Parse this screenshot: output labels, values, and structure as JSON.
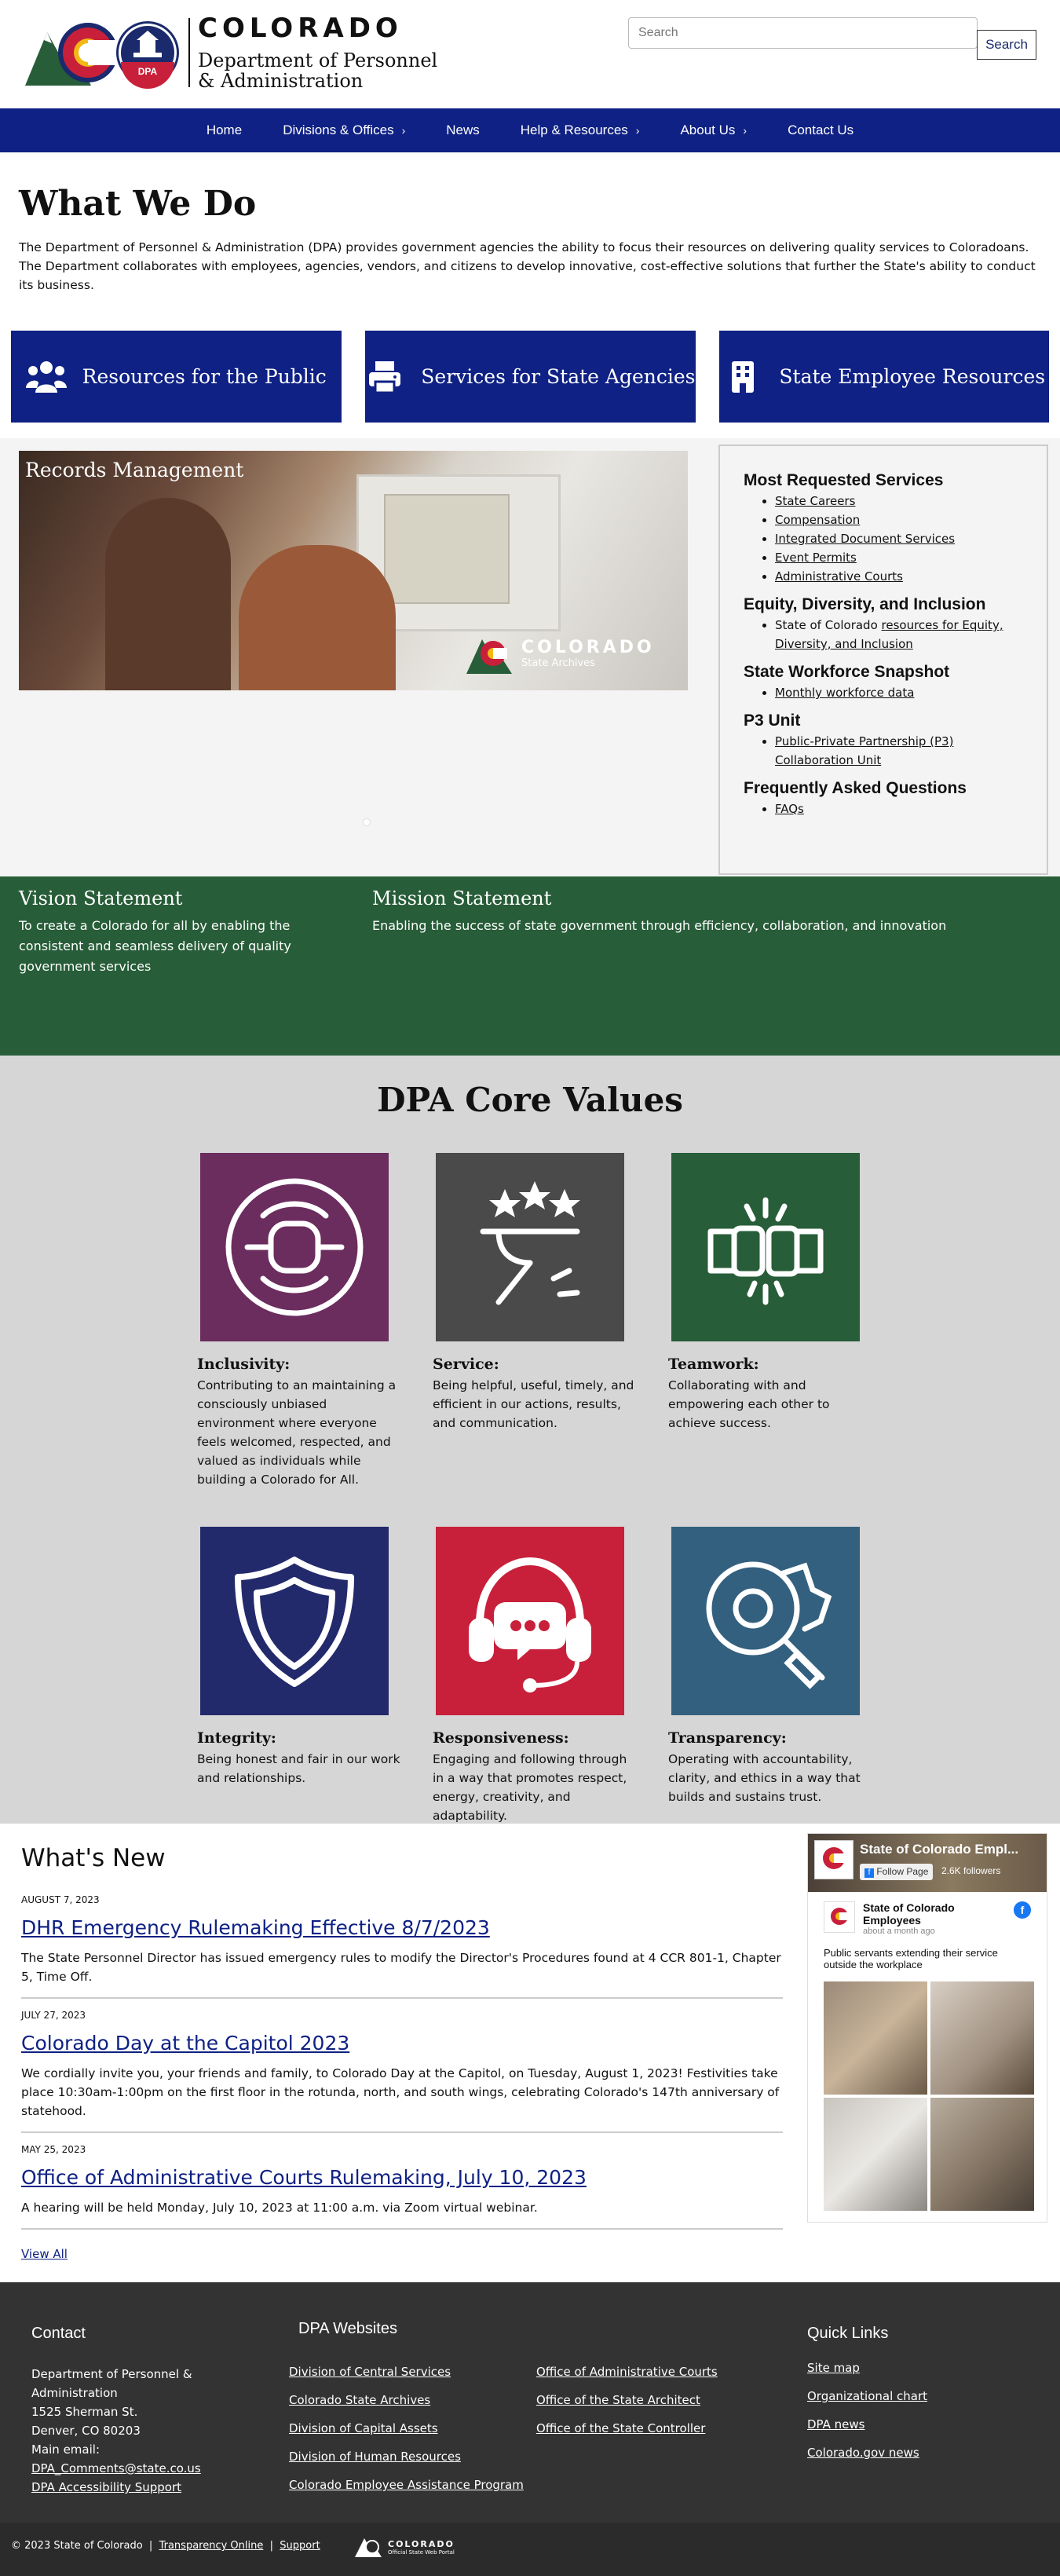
{
  "header": {
    "colorado": "COLORADO",
    "dept_line1": "Department of Personnel",
    "dept_line2": "& Administration",
    "dpa_badge": "DPA",
    "search_placeholder": "Search",
    "search_button": "Search"
  },
  "nav": [
    {
      "label": "Home",
      "chevron": false
    },
    {
      "label": "Divisions & Offices",
      "chevron": true
    },
    {
      "label": "News",
      "chevron": false
    },
    {
      "label": "Help & Resources",
      "chevron": true
    },
    {
      "label": "About Us",
      "chevron": true
    },
    {
      "label": "Contact Us",
      "chevron": false
    }
  ],
  "what_we_do": {
    "title": "What We Do",
    "text": "The Department of Personnel & Administration (DPA) provides government agencies the ability to focus their resources on delivering quality services to Coloradoans. The Department collaborates with employees, agencies, vendors, and citizens to develop innovative, cost-effective solutions that further the State's ability to conduct its business."
  },
  "cards": [
    {
      "label": "Resources for the Public",
      "icon": "people-icon"
    },
    {
      "label": "Services for State Agencies",
      "icon": "printer-icon"
    },
    {
      "label": "State Employee Resources",
      "icon": "building-icon"
    }
  ],
  "slide": {
    "title": "Records Management",
    "logo_name": "COLORADO",
    "logo_sub": "State Archives"
  },
  "services": {
    "groups": [
      {
        "title": "Most Requested Services",
        "items": [
          "State Careers",
          "Compensation",
          "Integrated Document Services",
          "Event Permits",
          "Administrative Courts"
        ]
      },
      {
        "title": "Equity, Diversity, and Inclusion",
        "items": [
          "resources for Equity, Diversity, and Inclusion"
        ],
        "prefix": "State of Colorado "
      },
      {
        "title": "State Workforce Snapshot",
        "items": [
          "Monthly workforce data"
        ]
      },
      {
        "title": "P3 Unit",
        "items": [
          "Public-Private Partnership (P3) Collaboration Unit"
        ]
      },
      {
        "title": "Frequently Asked Questions",
        "items": [
          "FAQs"
        ]
      }
    ]
  },
  "vision": {
    "title": "Vision Statement",
    "text": "To create a Colorado for all by enabling the consistent and seamless delivery of quality government services"
  },
  "mission": {
    "title": "Mission Statement",
    "text": "Enabling the success of state government through efficiency, collaboration, and innovation"
  },
  "core_values": {
    "title": "DPA Core Values",
    "items": [
      {
        "title": "Inclusivity:",
        "text": "Contributing to an maintaining a consciously unbiased environment where everyone feels welcomed, respected, and valued as individuals while building a Colorado for All.",
        "color": "#6b2c5e",
        "icon": "joined-hands-icon"
      },
      {
        "title": "Service:",
        "text": "Being helpful, useful, timely, and efficient in our actions, results, and communication.",
        "color": "#4a4a4a",
        "icon": "serving-tray-icon"
      },
      {
        "title": "Teamwork:",
        "text": "Collaborating with and empowering each other to achieve success.",
        "color": "#275d38",
        "icon": "fist-bump-icon"
      },
      {
        "title": "Integrity:",
        "text": "Being honest and fair in our work and relationships.",
        "color": "#232a6b",
        "icon": "shield-icon"
      },
      {
        "title": "Responsiveness:",
        "text": "Engaging and following through in a way that promotes respect, energy, creativity, and adaptability.",
        "color": "#c8203a",
        "icon": "headset-icon"
      },
      {
        "title": "Transparency:",
        "text": "Operating with accountability, clarity, and ethics in a way that builds and sustains trust.",
        "color": "#33607e",
        "icon": "magnifier-gear-icon"
      }
    ]
  },
  "whats_new": {
    "title": "What's New",
    "items": [
      {
        "date": "AUGUST 7, 2023",
        "title": "DHR Emergency Rulemaking Effective 8/7/2023",
        "text": "The State Personnel Director has issued emergency rules to modify the Director's Procedures found at 4 CCR 801-1, Chapter 5, Time Off."
      },
      {
        "date": "JULY 27, 2023",
        "title": "Colorado Day at the Capitol 2023",
        "text": "We cordially invite you, your friends and family, to Colorado Day at the Capitol, on Tuesday, August 1, 2023!  Festivities take place 10:30am-1:00pm on the first floor in the rotunda, north, and south wings, celebrating Colorado's 147th anniversary of statehood."
      },
      {
        "date": "MAY 25, 2023",
        "title": "Office of Administrative Courts Rulemaking, July 10, 2023",
        "text": "A hearing will be held Monday, July 10, 2023 at 11:00 a.m. via Zoom virtual webinar."
      }
    ],
    "view_all": "View All"
  },
  "facebook": {
    "title": "State of Colorado Empl...",
    "follow": "Follow Page",
    "followers": "2.6K followers",
    "page_name_1": "State of Colorado",
    "page_name_2": "Employees",
    "time": "about a month ago",
    "post_text": "Public servants extending their service outside the workplace"
  },
  "footer": {
    "contact_title": "Contact",
    "contact_lines": [
      "Department of Personnel &",
      "Administration",
      "1525 Sherman St.",
      "Denver, CO 80203",
      "Main email:"
    ],
    "email": "DPA_Comments@state.co.us",
    "accessibility": "DPA Accessibility Support",
    "websites_title": "DPA Websites",
    "websites_col1": [
      "Division of Central Services",
      "Colorado State Archives",
      "Division of Capital Assets",
      "Division of Human Resources",
      "Colorado Employee Assistance Program"
    ],
    "websites_col2": [
      "Office of Administrative Courts",
      "Office of the State Architect",
      "Office of the State Controller"
    ],
    "quick_title": "Quick Links",
    "quick_links": [
      "Site map",
      "Organizational chart",
      "DPA news",
      "Colorado.gov news"
    ]
  },
  "bottom": {
    "copyright": "© 2023 State of Colorado",
    "transparency": "Transparency Online",
    "support": "Support",
    "logo_name": "COLORADO",
    "logo_sub": "Official State Web Portal"
  },
  "colors": {
    "navy": "#0f2184",
    "green": "#275d38",
    "gray_band": "#d6d6d6",
    "footer": "#333333"
  }
}
